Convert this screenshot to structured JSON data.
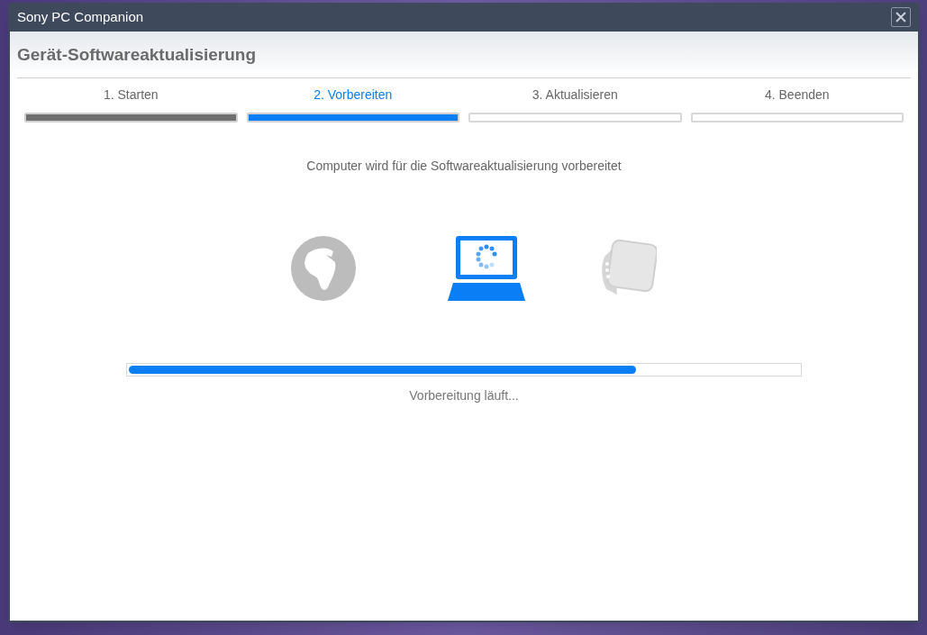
{
  "window": {
    "title": "Sony PC Companion"
  },
  "heading": "Gerät-Softwareaktualisierung",
  "steps": [
    {
      "label": "1. Starten",
      "completed": true,
      "selected": false
    },
    {
      "label": "2. Vorbereiten",
      "completed": false,
      "selected": true
    },
    {
      "label": "3. Aktualisieren",
      "completed": false,
      "selected": false
    },
    {
      "label": "4. Beenden",
      "completed": false,
      "selected": false
    }
  ],
  "message": "Computer wird für die Softwareaktualisierung vorbereitet",
  "progress": {
    "level": 0.757,
    "caption": "Vorbereitung läuft..."
  }
}
